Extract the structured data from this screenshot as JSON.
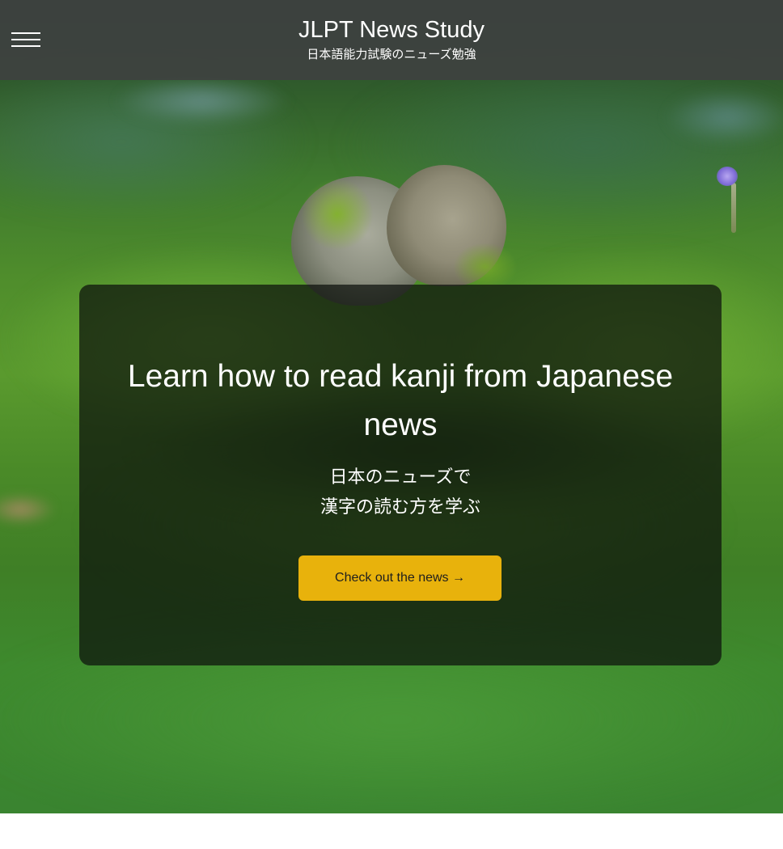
{
  "header": {
    "title": "JLPT News Study",
    "subtitle": "日本語能力試験のニューズ勉強",
    "menu_icon": "hamburger-menu-icon"
  },
  "hero": {
    "heading": "Learn how to read kanji from Japanese news",
    "jp_line1": "日本のニューズで",
    "jp_line2": "漢字の読む方を学ぶ",
    "cta_label": "Check out the news →"
  },
  "colors": {
    "header_bg": "#3e4240",
    "card_bg": "#0c100c",
    "cta_bg": "#e8b20c",
    "cta_text": "#1e1e1e",
    "text": "#ffffff"
  }
}
